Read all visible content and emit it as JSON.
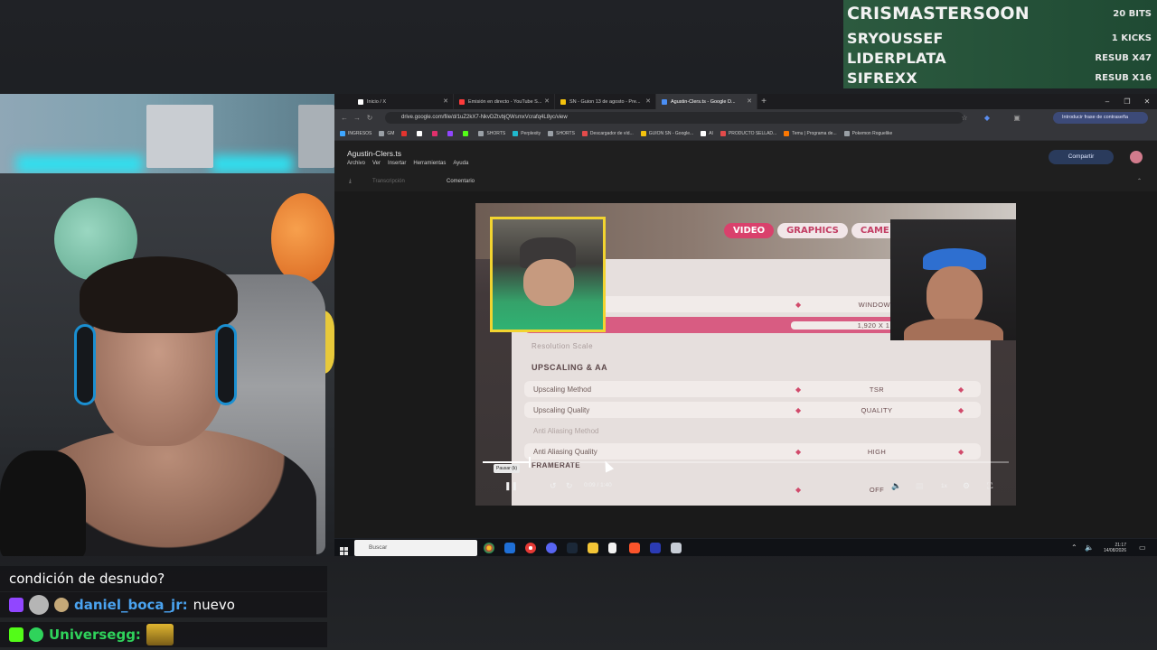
{
  "alerts": [
    {
      "name": "CRISMASTERSOON",
      "value": "20 BITS"
    },
    {
      "name": "SRYOUSSEF",
      "value": "1 KICKS"
    },
    {
      "name": "LIDERPLATA",
      "value": "RESUB X47"
    },
    {
      "name": "SIFREXX",
      "value": "RESUB X16"
    }
  ],
  "chat": {
    "line1": {
      "message": "condición de desnudo?"
    },
    "line2": {
      "user": "daniel_boca_jr:",
      "message": "nuevo",
      "user_color": "#4aa3f0"
    },
    "line3": {
      "user": "Universegg:",
      "user_color": "#2fd35b"
    }
  },
  "browser": {
    "tabs": [
      {
        "label": "Inicio / X",
        "color": "#ffffff"
      },
      {
        "label": "Emisión en directo - YouTube S...",
        "color": "#ff3b3b"
      },
      {
        "label": "SN - Guion 13 de agosto - Pre...",
        "color": "#f4c20d"
      },
      {
        "label": "Agustin-Clers.ts - Google D...",
        "color": "#4b8ff5",
        "active": true
      }
    ],
    "url": "drive.google.com/file/d/1uZ2kX7-NkvDZtvbjQWsmxVcrafq4L8yc/view",
    "password_prompt": "Introducir frase de contraseña",
    "bookmarks": [
      "INGRESOS",
      "GM",
      "SHORTS",
      "Perplexity",
      "SHORTS",
      "Descargador de víd...",
      "GUION SN - Google...",
      "AI",
      "PRODUCTO SELLAD...",
      "Temu | Programa de...",
      "Pokemon Roguelike"
    ]
  },
  "drive": {
    "filename": "Agustin-Clers.ts",
    "menus": [
      "Archivo",
      "Ver",
      "Insertar",
      "Herramientas",
      "Ayuda"
    ],
    "share_label": "Compartir",
    "toolbar": {
      "transcription": "Transcripción",
      "comment": "Comentario"
    }
  },
  "video": {
    "tabs": [
      "VIDEO",
      "GRAPHICS",
      "CAME"
    ],
    "rows_top": [
      {
        "value": "WINDOWE"
      },
      {
        "value": "1,920 X 1,2"
      }
    ],
    "resolution_scale": "Resolution Scale",
    "section_upscaling": "UPSCALING & AA",
    "rows": [
      {
        "label": "Upscaling Method",
        "value": "TSR"
      },
      {
        "label": "Upscaling Quality",
        "value": "QUALITY"
      },
      {
        "label": "Anti Aliasing Method",
        "value": ""
      },
      {
        "label": "Anti Aliasing Quality",
        "value": "HIGH"
      }
    ],
    "section_framerate": "FRAMERATE",
    "last_value": "OFF",
    "tooltip": "Pausar (k)",
    "time": "0:09 / 1:40",
    "progress_fraction": 0.09,
    "speed": "1x"
  },
  "taskbar": {
    "search_placeholder": "Buscar",
    "time": "21:17",
    "date": "14/08/2026"
  }
}
